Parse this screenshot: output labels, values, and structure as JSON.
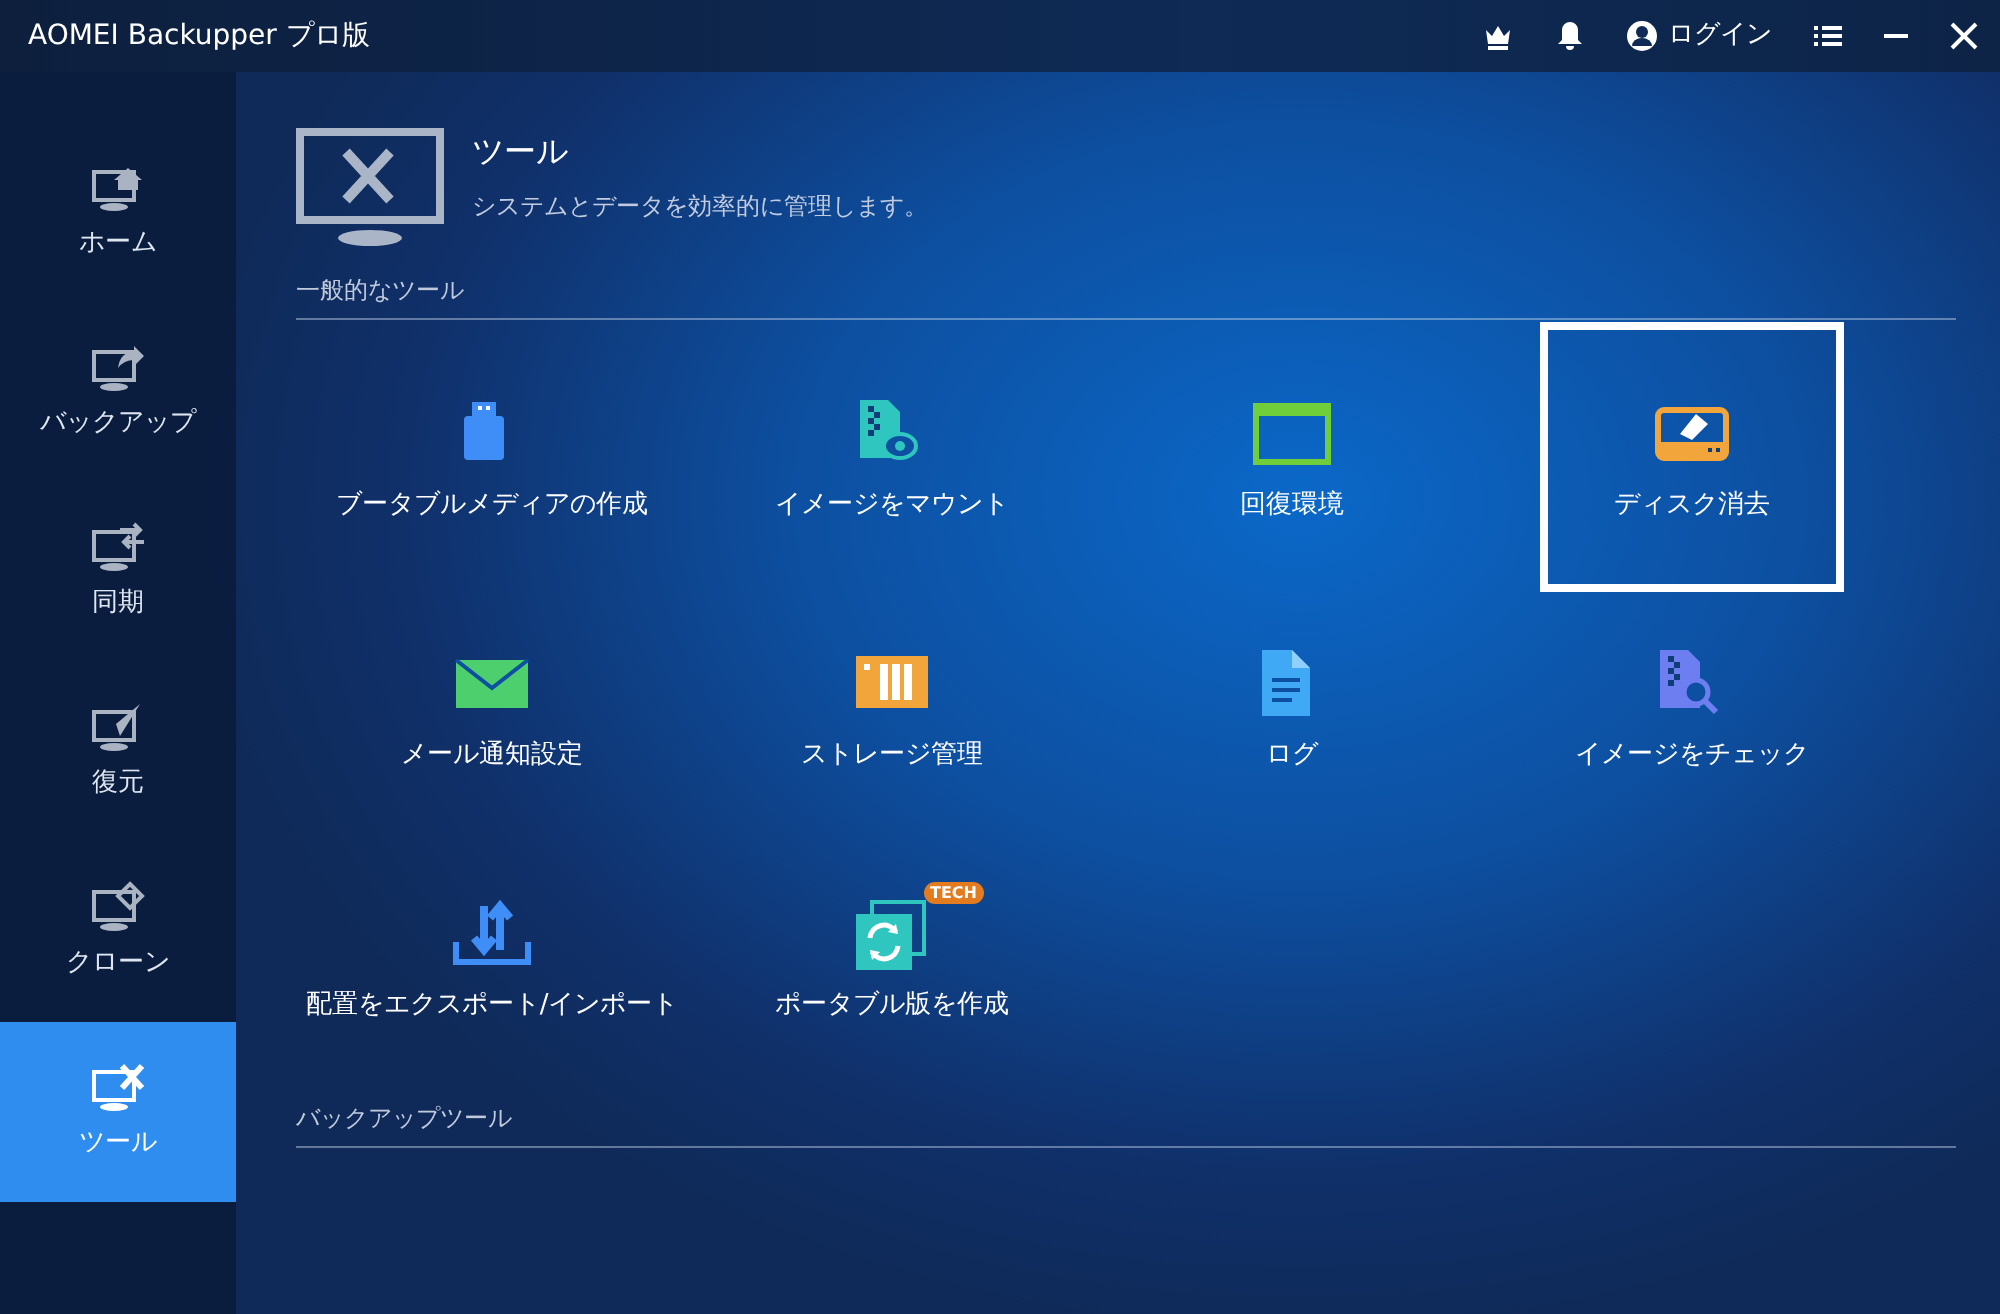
{
  "window": {
    "title": "AOMEI Backupper プロ版",
    "login": "ログイン"
  },
  "sidebar": {
    "items": [
      {
        "kind": "home",
        "label": "ホーム",
        "selected": false
      },
      {
        "kind": "backup",
        "label": "バックアップ",
        "selected": false
      },
      {
        "kind": "sync",
        "label": "同期",
        "selected": false
      },
      {
        "kind": "restore",
        "label": "復元",
        "selected": false
      },
      {
        "kind": "clone",
        "label": "クローン",
        "selected": false
      },
      {
        "kind": "tools",
        "label": "ツール",
        "selected": true
      }
    ]
  },
  "header": {
    "title": "ツール",
    "subtitle": "システムとデータを効率的に管理します。"
  },
  "sections": [
    {
      "title": "一般的なツール",
      "tools": [
        {
          "kind": "usb",
          "label": "ブータブルメディアの作成",
          "selected": false
        },
        {
          "kind": "mount",
          "label": "イメージをマウント",
          "selected": false
        },
        {
          "kind": "window",
          "label": "回復環境",
          "selected": false
        },
        {
          "kind": "wipe",
          "label": "ディスク消去",
          "selected": true
        },
        {
          "kind": "mail",
          "label": "メール通知設定",
          "selected": false
        },
        {
          "kind": "storage",
          "label": "ストレージ管理",
          "selected": false
        },
        {
          "kind": "log",
          "label": "ログ",
          "selected": false
        },
        {
          "kind": "check",
          "label": "イメージをチェック",
          "selected": false
        },
        {
          "kind": "export",
          "label": "配置をエクスポート/インポート",
          "selected": false
        },
        {
          "kind": "portable",
          "label": "ポータブル版を作成",
          "selected": false,
          "badge": "TECH"
        }
      ]
    },
    {
      "title": "バックアップツール"
    }
  ]
}
